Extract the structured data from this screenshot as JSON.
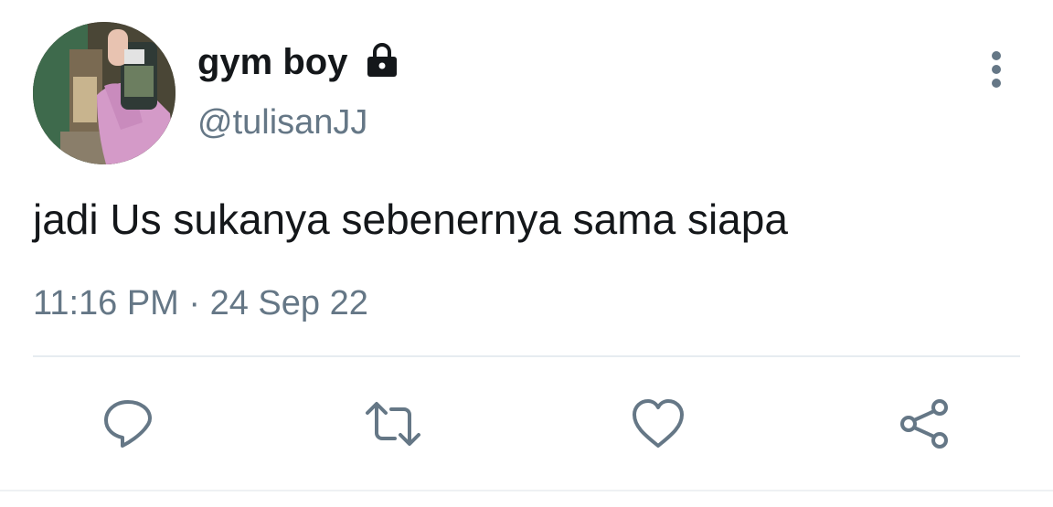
{
  "user": {
    "display_name": "gym boy",
    "handle": "@tulisanJJ",
    "protected_icon": "lock-icon",
    "avatar_alt": "profile picture"
  },
  "tweet": {
    "text": "jadi Us sukanya sebenernya sama siapa",
    "timestamp": "11:16 PM · 24 Sep 22"
  },
  "actions": [
    {
      "name": "reply",
      "icon": "reply-icon"
    },
    {
      "name": "retweet",
      "icon": "retweet-icon"
    },
    {
      "name": "like",
      "icon": "heart-icon"
    },
    {
      "name": "share",
      "icon": "share-icon"
    }
  ],
  "menu": {
    "icon": "more-vertical-icon"
  },
  "colors": {
    "text_primary": "#14171a",
    "text_secondary": "#657786",
    "icon": "#657786",
    "divider": "#e6ecf0"
  }
}
